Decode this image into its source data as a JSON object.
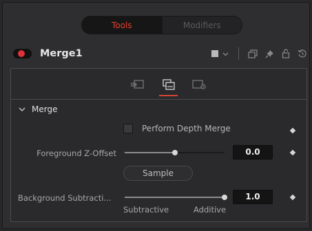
{
  "tabs": [
    {
      "label": "Tools",
      "active": true
    },
    {
      "label": "Modifiers",
      "active": false
    }
  ],
  "node": {
    "name": "Merge1",
    "enabled_color": "#e0323a"
  },
  "header_icons": [
    "color-swatch-icon",
    "chevron-down-icon",
    "versions-icon",
    "pin-icon",
    "lock-icon",
    "reset-icon"
  ],
  "subtabs": [
    {
      "icon": "merge-controls-icon",
      "active": false
    },
    {
      "icon": "channels-icon",
      "active": true
    },
    {
      "icon": "settings-icon",
      "active": false
    }
  ],
  "section": {
    "title": "Merge",
    "expanded": true
  },
  "controls": {
    "depth_merge": {
      "label": "Perform Depth Merge",
      "checked": false
    },
    "fg_z_offset": {
      "label": "Foreground Z-Offset",
      "value": "0.0",
      "slider_fraction": 0.5
    },
    "sample_button": {
      "label": "Sample"
    },
    "bg_subtraction": {
      "label": "Background Subtracti...",
      "value": "1.0",
      "slider_fraction": 1.0,
      "min_label": "Subtractive",
      "max_label": "Additive"
    }
  },
  "colors": {
    "accent": "#e3442e",
    "background": "#28282a",
    "panel": "#2a2a2c"
  }
}
